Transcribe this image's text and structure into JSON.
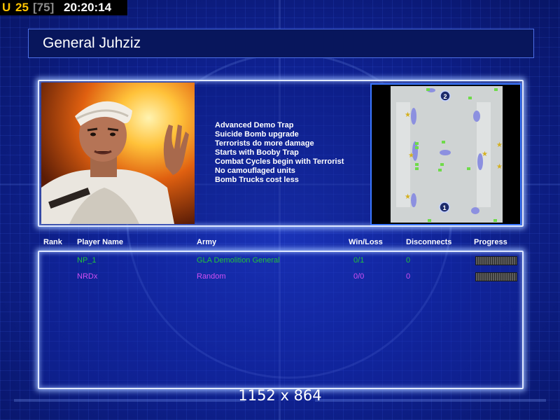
{
  "hud": {
    "prefix": "U",
    "unit_count": "25",
    "unit_max": "[75]",
    "clock": "20:20:14"
  },
  "title": "General Juhziz",
  "portrait": {
    "icon": "general-portrait"
  },
  "bonuses": [
    "Advanced Demo Trap",
    "Suicide Bomb upgrade",
    "Terrorists do more damage",
    "Starts with Booby Trap",
    "Combat Cycles begin with Terrorist",
    "No camouflaged units",
    "Bomb Trucks cost less"
  ],
  "minimap": {
    "start_positions": [
      "2",
      "1"
    ]
  },
  "table": {
    "headers": {
      "rank": "Rank",
      "player": "Player Name",
      "army": "Army",
      "winloss": "Win/Loss",
      "disconnects": "Disconnects",
      "progress": "Progress"
    },
    "rows": [
      {
        "rank": "",
        "player": "NP_1",
        "army": "GLA Demolition General",
        "winloss": "0/1",
        "disconnects": "0",
        "color": "#22c23a"
      },
      {
        "rank": "",
        "player": "NRDx",
        "army": "Random",
        "winloss": "0/0",
        "disconnects": "0",
        "color": "#d24ff4"
      }
    ]
  },
  "resolution": "1152 x 864"
}
